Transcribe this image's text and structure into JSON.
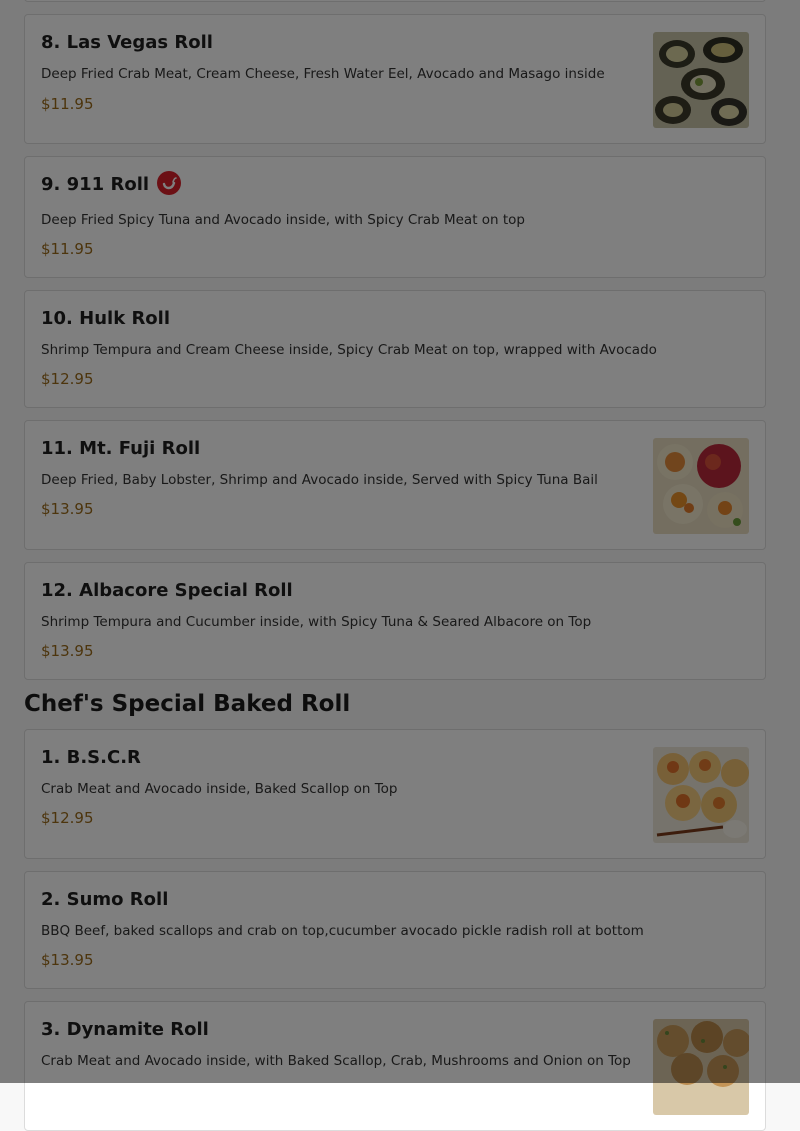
{
  "colors": {
    "price": "#9a6a1a",
    "spicy_badge": "#d8202a",
    "overlay": "rgba(0,0,0,0.5)"
  },
  "items": [
    {
      "name": "8. Las Vegas Roll",
      "desc": "Deep Fried Crab Meat, Cream Cheese, Fresh Water Eel, Avocado and Masago inside",
      "price": "$11.95",
      "image": "las-vegas-roll-photo"
    },
    {
      "name": "9. 911 Roll",
      "desc": "Deep Fried Spicy Tuna and Avocado inside, with Spicy Crab Meat on top",
      "price": "$11.95",
      "icon": "spicy-chili-icon"
    },
    {
      "name": "10. Hulk Roll",
      "desc": "Shrimp Tempura and Cream Cheese inside, Spicy Crab Meat on top, wrapped with Avocado",
      "price": "$12.95"
    },
    {
      "name": "11. Mt. Fuji Roll",
      "desc": "Deep Fried, Baby Lobster, Shrimp and Avocado inside, Served with Spicy Tuna Bail",
      "price": "$13.95",
      "image": "mt-fuji-roll-photo"
    },
    {
      "name": "12. Albacore Special Roll",
      "desc": "Shrimp Tempura and Cucumber inside, with Spicy Tuna & Seared Albacore on Top",
      "price": "$13.95"
    }
  ],
  "section": {
    "title": "Chef's Special Baked Roll"
  },
  "baked": [
    {
      "name": "1. B.S.C.R",
      "desc": "Crab Meat and Avocado inside, Baked Scallop on Top",
      "price": "$12.95",
      "image": "bscr-roll-photo"
    },
    {
      "name": "2. Sumo Roll",
      "desc": "BBQ Beef, baked scallops and crab on top,cucumber avocado pickle radish roll at bottom",
      "price": "$13.95"
    },
    {
      "name": "3. Dynamite Roll",
      "desc": "Crab Meat and Avocado inside, with Baked Scallop, Crab, Mushrooms and Onion on Top",
      "price": "",
      "image": "dynamite-roll-photo"
    }
  ]
}
